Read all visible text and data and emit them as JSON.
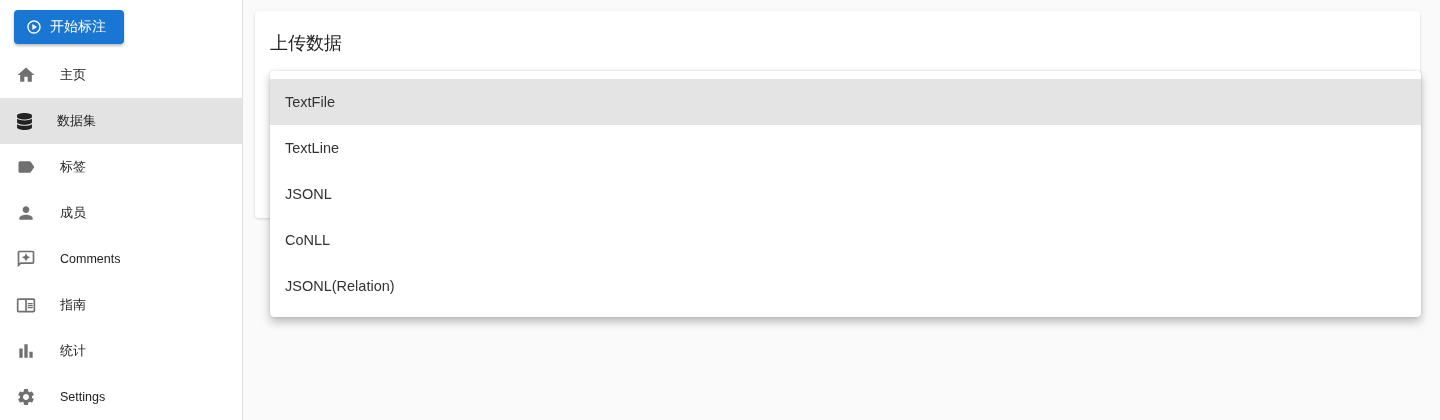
{
  "start_button": {
    "label": "开始标注"
  },
  "sidebar": {
    "items": [
      {
        "kind": "home",
        "label": "主页",
        "selected": false
      },
      {
        "kind": "dataset",
        "label": "数据集",
        "selected": true
      },
      {
        "kind": "label",
        "label": "标签",
        "selected": false
      },
      {
        "kind": "member",
        "label": "成员",
        "selected": false
      },
      {
        "kind": "comment",
        "label": "Comments",
        "selected": false
      },
      {
        "kind": "guide",
        "label": "指南",
        "selected": false
      },
      {
        "kind": "stats",
        "label": "统计",
        "selected": false
      },
      {
        "kind": "settings",
        "label": "Settings",
        "selected": false
      }
    ]
  },
  "card": {
    "title": "上传数据"
  },
  "menu": {
    "options": [
      {
        "label": "TextFile",
        "selected": true
      },
      {
        "label": "TextLine",
        "selected": false
      },
      {
        "label": "JSONL",
        "selected": false
      },
      {
        "label": "CoNLL",
        "selected": false
      },
      {
        "label": "JSONL(Relation)",
        "selected": false
      }
    ]
  }
}
